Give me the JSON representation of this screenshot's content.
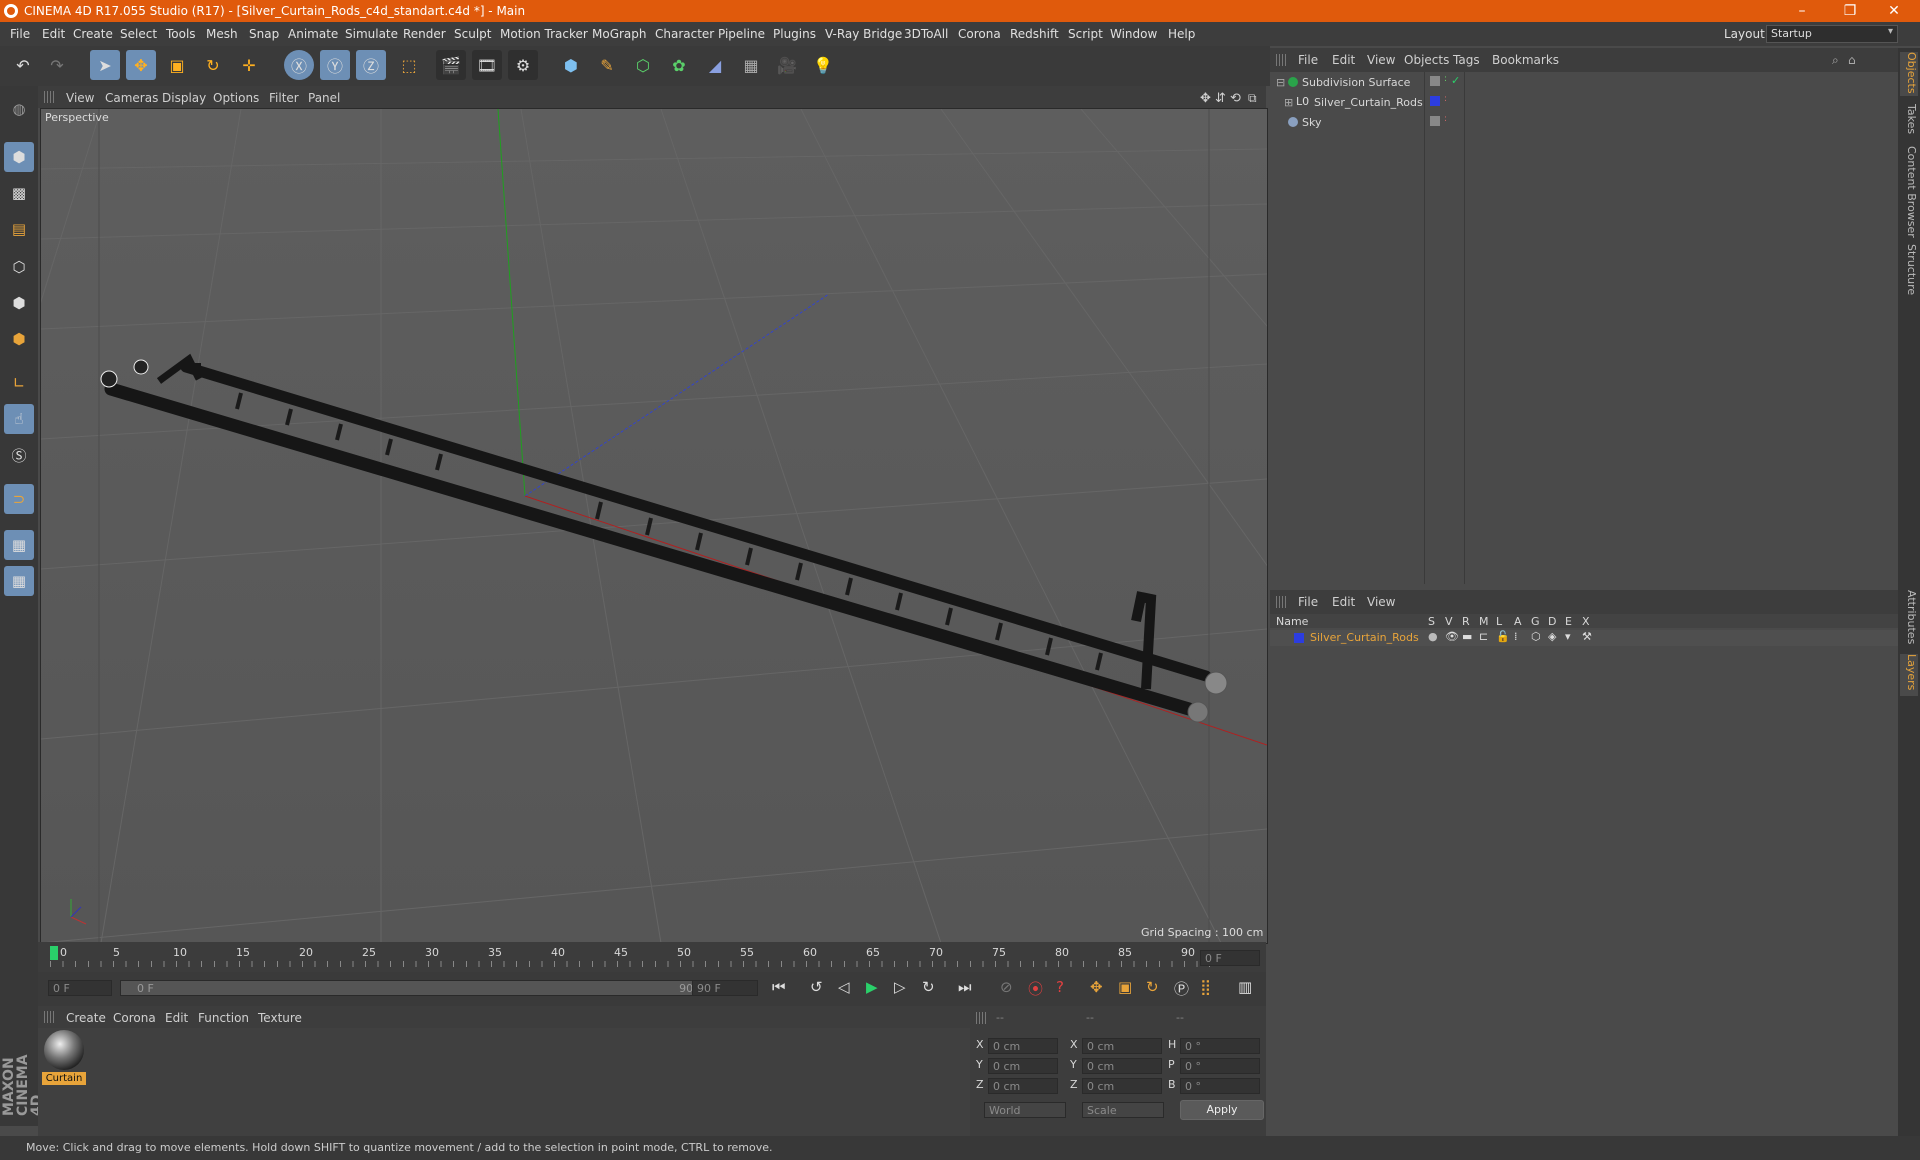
{
  "window": {
    "title": "CINEMA 4D R17.055 Studio (R17) - [Silver_Curtain_Rods_c4d_standart.c4d *] - Main",
    "minimize": "–",
    "restore": "❐",
    "close": "✕"
  },
  "menubar": [
    "File",
    "Edit",
    "Create",
    "Select",
    "Tools",
    "Mesh",
    "Snap",
    "Animate",
    "Simulate",
    "Render",
    "Sculpt",
    "Motion Tracker",
    "MoGraph",
    "Character",
    "Pipeline",
    "Plugins",
    "V-Ray Bridge",
    "3DToAll",
    "Corona",
    "Redshift",
    "Script",
    "Window",
    "Help"
  ],
  "layout": {
    "label": "Layout:",
    "value": "Startup"
  },
  "viewport": {
    "menu": [
      "View",
      "Cameras",
      "Display",
      "Options",
      "Filter",
      "Panel"
    ],
    "label": "Perspective",
    "grid_spacing": "Grid Spacing : 100 cm"
  },
  "timeline": {
    "ticks": [
      "0",
      "5",
      "10",
      "15",
      "20",
      "25",
      "30",
      "35",
      "40",
      "45",
      "50",
      "55",
      "60",
      "65",
      "70",
      "75",
      "80",
      "85",
      "90"
    ],
    "current_frame": "0 F",
    "start_frame": "0 F",
    "range_start": "0 F",
    "range_end": "90 F",
    "end_frame": "90 F"
  },
  "material_panel": {
    "menu": [
      "Create",
      "Corona",
      "Edit",
      "Function",
      "Texture"
    ],
    "materials": [
      {
        "name": "Curtain"
      }
    ]
  },
  "coords": {
    "headers": [
      "--",
      "--",
      "--"
    ],
    "rows": [
      {
        "l1": "X",
        "v1": "0 cm",
        "l2": "X",
        "v2": "0 cm",
        "l3": "H",
        "v3": "0 °"
      },
      {
        "l1": "Y",
        "v1": "0 cm",
        "l2": "Y",
        "v2": "0 cm",
        "l3": "P",
        "v3": "0 °"
      },
      {
        "l1": "Z",
        "v1": "0 cm",
        "l2": "Z",
        "v2": "0 cm",
        "l3": "B",
        "v3": "0 °"
      }
    ],
    "mode": "World",
    "transform": "Scale",
    "apply": "Apply"
  },
  "object_manager": {
    "menu": [
      "File",
      "Edit",
      "View",
      "Objects",
      "Tags",
      "Bookmarks"
    ],
    "objects": [
      {
        "name": "Subdivision Surface",
        "color": "#2aa34a"
      },
      {
        "name": "Silver_Curtain_Rods",
        "color": "#2c3de0"
      },
      {
        "name": "Sky",
        "color": "#8aa0c0"
      }
    ]
  },
  "layer_manager": {
    "menu": [
      "File",
      "Edit",
      "View"
    ],
    "columns": [
      "Name",
      "S",
      "V",
      "R",
      "M",
      "L",
      "A",
      "G",
      "D",
      "E",
      "X"
    ],
    "layers": [
      {
        "name": "Silver_Curtain_Rods",
        "color": "#2c3de0"
      }
    ]
  },
  "right_tabs": [
    "Objects",
    "Takes",
    "Content Browser",
    "Structure",
    "Attributes",
    "Layers"
  ],
  "status": "Move: Click and drag to move elements. Hold down SHIFT to quantize movement / add to the selection in point mode, CTRL to remove.",
  "brand": "MAXON CINEMA 4D",
  "colors": {
    "accent": "#e05a0c",
    "highlight": "#e8a43a",
    "tool_blue": "#6d8fb5"
  }
}
